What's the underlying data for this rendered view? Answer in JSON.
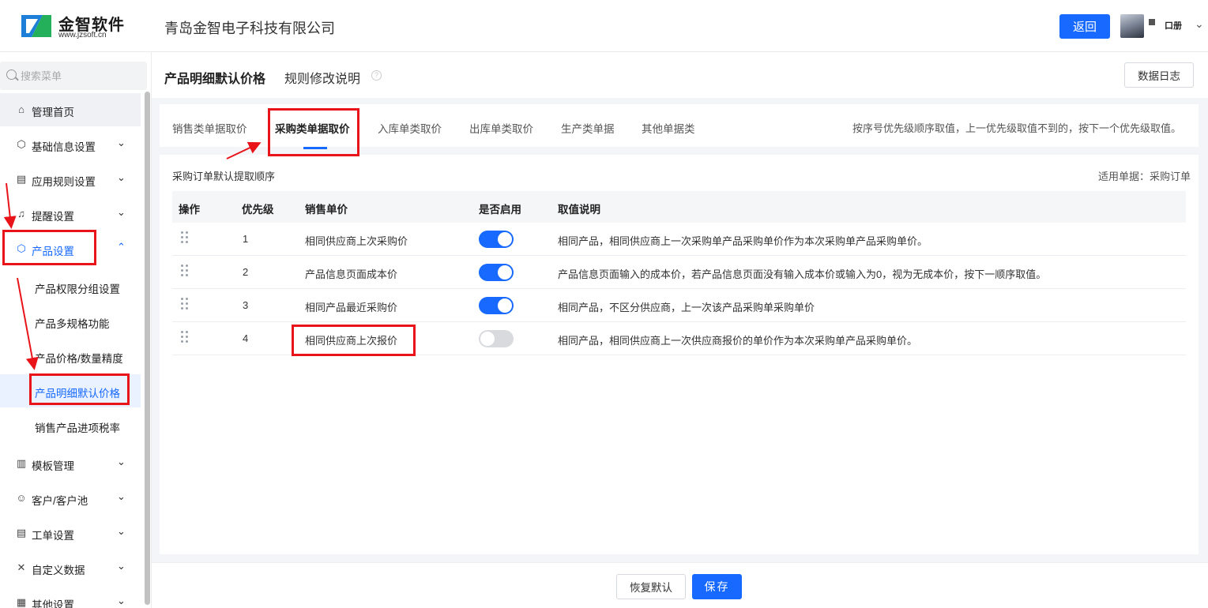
{
  "header": {
    "logo_text": "金智软件",
    "logo_url": "www.jzsoft.cn",
    "company": "青岛金智电子科技有限公司",
    "back_label": "返回",
    "user_name": "口册",
    "user_caret": "⌄"
  },
  "sidebar": {
    "search_placeholder": "搜索菜单",
    "items": [
      {
        "label": "管理首页",
        "icon": "home-icon",
        "glyph": "⌂"
      },
      {
        "label": "基础信息设置",
        "icon": "cube-icon",
        "glyph": "⬡"
      },
      {
        "label": "应用规则设置",
        "icon": "document-icon",
        "glyph": "▤"
      },
      {
        "label": "提醒设置",
        "icon": "bell-icon",
        "glyph": "♫"
      },
      {
        "label": "产品设置",
        "icon": "cube-icon",
        "glyph": "⬡"
      },
      {
        "label": "模板管理",
        "icon": "template-icon",
        "glyph": "▥"
      },
      {
        "label": "客户/客户池",
        "icon": "user-icon",
        "glyph": "☺"
      },
      {
        "label": "工单设置",
        "icon": "list-icon",
        "glyph": "▤"
      },
      {
        "label": "自定义数据",
        "icon": "tools-icon",
        "glyph": "✕"
      },
      {
        "label": "其他设置",
        "icon": "grid-icon",
        "glyph": "▦"
      }
    ],
    "sub_items": [
      {
        "label": "产品权限分组设置"
      },
      {
        "label": "产品多规格功能"
      },
      {
        "label": "产品价格/数量精度"
      },
      {
        "label": "产品明细默认价格"
      },
      {
        "label": "销售产品进项税率"
      }
    ]
  },
  "page": {
    "title": "产品明细默认价格",
    "rule_link": "规则修改说明",
    "help_glyph": "?",
    "log_label": "数据日志"
  },
  "tabs": {
    "items": [
      {
        "label": "销售类单据取价"
      },
      {
        "label": "采购类单据取价"
      },
      {
        "label": "入库单类取价"
      },
      {
        "label": "出库单类取价"
      },
      {
        "label": "生产类单据"
      },
      {
        "label": "其他单据类"
      }
    ],
    "active": "采购类单据取价",
    "hint": "按序号优先级顺序取值，上一优先级取值不到的，按下一个优先级取值。"
  },
  "content": {
    "section_label": "采购订单默认提取顺序",
    "apply_doc": "适用单据：采购订单",
    "columns": [
      "操作",
      "优先级",
      "销售单价",
      "是否启用",
      "取值说明"
    ],
    "rows": [
      {
        "priority": "1",
        "price": "相同供应商上次采购价",
        "enabled": true,
        "desc": "相同产品，相同供应商上一次采购单产品采购单价作为本次采购单产品采购单价。"
      },
      {
        "priority": "2",
        "price": "产品信息页面成本价",
        "enabled": true,
        "desc": "产品信息页面输入的成本价，若产品信息页面没有输入成本价或输入为0，视为无成本价，按下一顺序取值。"
      },
      {
        "priority": "3",
        "price": "相同产品最近采购价",
        "enabled": true,
        "desc": "相同产品，不区分供应商，上一次该产品采购单采购单价"
      },
      {
        "priority": "4",
        "price": "相同供应商上次报价",
        "enabled": false,
        "desc": "相同产品，相同供应商上一次供应商报价的单价作为本次采购单产品采购单价。"
      }
    ]
  },
  "footer": {
    "reset_label": "恢复默认",
    "save_label": "保存"
  },
  "colors": {
    "accent": "#1769ff",
    "annotation": "#e8141a",
    "toggle_off": "#d8dade"
  }
}
